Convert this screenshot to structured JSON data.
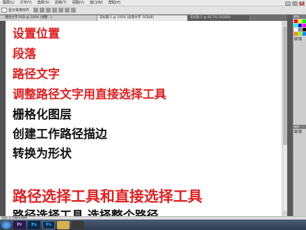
{
  "menubar": {
    "items": [
      "图层(L)",
      "文字(Y)",
      "选择(S)",
      "滤镜(T)",
      "视图(V)",
      "窗口(W)",
      "帮助(H)"
    ]
  },
  "window_controls": [
    "_",
    "□",
    "×"
  ],
  "options": {
    "show_transform": "显示变换控件"
  },
  "tabs": [
    {
      "label": "…路径文字.PSD @ 100% (调整…)",
      "active": false
    },
    {
      "label": "未标题-1 @ 100% (段落文字, RGB/8)",
      "active": true
    },
    {
      "label": "未标题-2 @ 66.7% (RGB/8)",
      "active": false
    }
  ],
  "document": {
    "lines": [
      {
        "text": "设置位置",
        "color": "red"
      },
      {
        "text": "段落",
        "color": "red"
      },
      {
        "text": "路径文字",
        "color": "red"
      },
      {
        "text": "调整路径文字用直接选择工具",
        "color": "red"
      },
      {
        "text": "栅格化图层",
        "color": "black"
      },
      {
        "text": "创建工作路径描边",
        "color": "black"
      },
      {
        "text": "转换为形状",
        "color": "black"
      },
      {
        "text": "路径选择工具和直接选择工具",
        "color": "red"
      },
      {
        "text": "路径选择工具 选择整个路径",
        "color": "black"
      }
    ],
    "colors": {
      "red": "#e02020",
      "black": "#111111"
    }
  },
  "panels": {
    "color_header": "颜色",
    "layers_header": "图层",
    "swatches": [
      "#ff0000",
      "#ffff00",
      "#00ff00",
      "#00ffff",
      "#0000ff",
      "#ff00ff",
      "#ffffff",
      "#888888",
      "#000000",
      "#ff8800",
      "#88ff00",
      "#0088ff"
    ]
  },
  "statusbar": {
    "text": "文档: 2.75M/4.99M"
  },
  "taskbar": {
    "apps": [
      {
        "name": "start",
        "icon": "windows-start-icon",
        "label": "",
        "color": ""
      },
      {
        "name": "premiere",
        "icon": "premiere-icon",
        "label": "Pr",
        "color": "#2a1a4a"
      },
      {
        "name": "photoshop-1",
        "icon": "photoshop-icon",
        "label": "Ps",
        "color": "#0b2a4a"
      },
      {
        "name": "photoshop-2",
        "icon": "photoshop-icon",
        "label": "Ps",
        "color": "#0b2a4a"
      },
      {
        "name": "file-explorer",
        "icon": "folder-icon",
        "label": "",
        "color": "#d6b24a"
      },
      {
        "name": "recorder",
        "icon": "camera-icon",
        "label": "",
        "color": "#3a3a3a"
      }
    ]
  }
}
